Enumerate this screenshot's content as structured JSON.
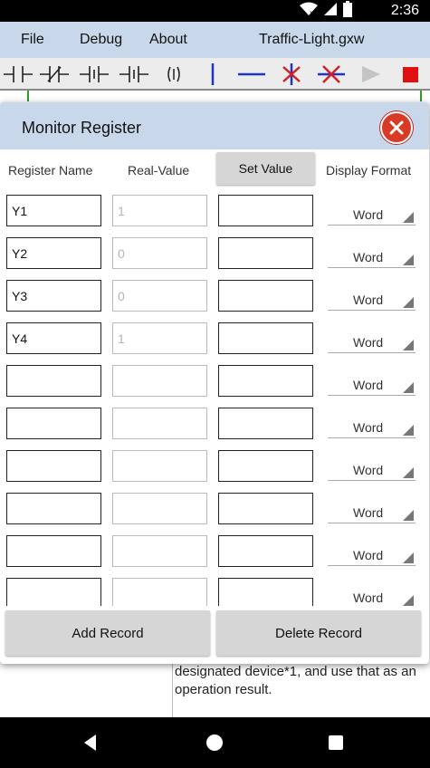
{
  "status_bar": {
    "time": "2:36",
    "icons": [
      "wifi-icon",
      "signal-icon",
      "battery-icon"
    ]
  },
  "menu": {
    "items": [
      "File",
      "Debug",
      "About"
    ],
    "file_title": "Traffic-Light.gxw"
  },
  "toolbar": {
    "tools": [
      "normally-open-contact-icon",
      "normally-closed-contact-icon",
      "rising-edge-contact-icon",
      "falling-edge-contact-icon",
      "coil-icon",
      "vertical-line-icon",
      "horizontal-line-icon",
      "delete-vertical-line-icon",
      "delete-horizontal-line-icon",
      "run-icon",
      "stop-icon"
    ]
  },
  "editor": {
    "partial_text": "designated device*1, and use that as an operation result."
  },
  "dialog": {
    "title": "Monitor Register",
    "headers": {
      "register_name": "Register Name",
      "real_value": "Real-Value",
      "set_value": "Set Value",
      "display_format": "Display Format"
    },
    "rows": [
      {
        "name": "Y1",
        "real": "1",
        "set": "",
        "format": "Word"
      },
      {
        "name": "Y2",
        "real": "0",
        "set": "",
        "format": "Word"
      },
      {
        "name": "Y3",
        "real": "0",
        "set": "",
        "format": "Word"
      },
      {
        "name": "Y4",
        "real": "1",
        "set": "",
        "format": "Word"
      },
      {
        "name": "",
        "real": "",
        "set": "",
        "format": "Word"
      },
      {
        "name": "",
        "real": "",
        "set": "",
        "format": "Word"
      },
      {
        "name": "",
        "real": "",
        "set": "",
        "format": "Word"
      },
      {
        "name": "",
        "real": "",
        "set": "",
        "format": "Word"
      },
      {
        "name": "",
        "real": "",
        "set": "",
        "format": "Word"
      },
      {
        "name": "",
        "real": "",
        "set": "",
        "format": "Word"
      }
    ],
    "add_record": "Add Record",
    "delete_record": "Delete Record"
  },
  "colors": {
    "menu_bar": "#c8d8ea",
    "close_button": "#d93a26",
    "line_tool_blue": "#2033c8",
    "delete_tool_red": "#d02020",
    "stop_red": "#e01010",
    "button_gray": "#d6d6d6"
  }
}
